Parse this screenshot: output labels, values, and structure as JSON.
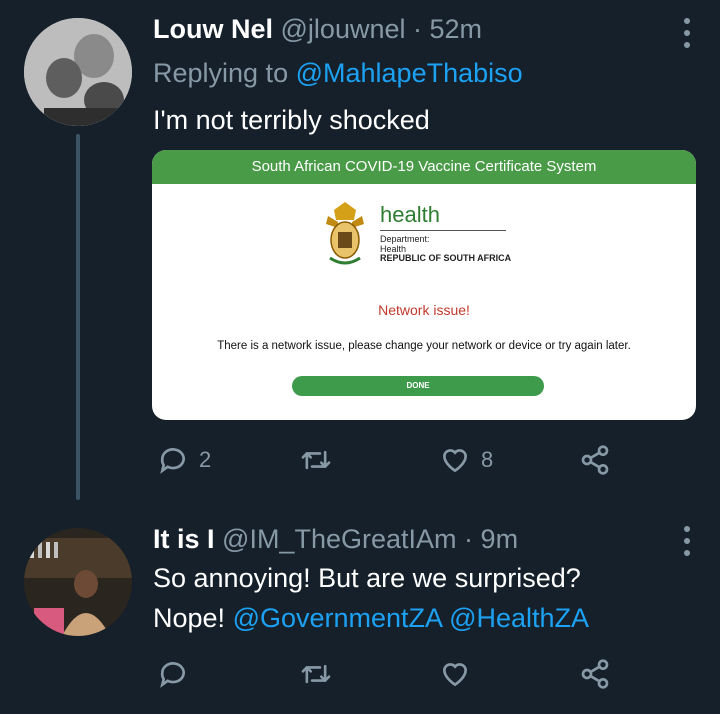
{
  "tweets": [
    {
      "name": "Louw Nel",
      "handle": "@jlouwnel",
      "separator": "·",
      "time": "52m",
      "replying_prefix": "Replying to",
      "replying_to": "@MahlapeThabiso",
      "text": "I'm not terribly shocked",
      "card": {
        "header": "South African COVID-19 Vaccine Certificate System",
        "logo_word": "health",
        "dept_line1": "Department:",
        "dept_line2": "Health",
        "dept_line3": "REPUBLIC OF SOUTH AFRICA",
        "error_title": "Network issue!",
        "error_message": "There is a network issue, please change your network or device or try again later.",
        "done_label": "DONE"
      },
      "reply_count": "2",
      "retweet_count": "",
      "like_count": "8"
    },
    {
      "name": "It is I",
      "handle": "@IM_TheGreatIAm",
      "separator": "·",
      "time": "9m",
      "text_line1": "So annoying! But are we surprised?",
      "text_line2_prefix": "Nope!",
      "mention1": "@GovernmentZA",
      "mention2": "@HealthZA",
      "reply_count": "",
      "retweet_count": "",
      "like_count": ""
    }
  ],
  "colors": {
    "background": "#15202b",
    "secondary_text": "#8899a6",
    "link": "#1da1f2",
    "card_green": "#4a9b48"
  },
  "icons": [
    "reply-icon",
    "retweet-icon",
    "like-icon",
    "share-icon",
    "more-icon"
  ]
}
